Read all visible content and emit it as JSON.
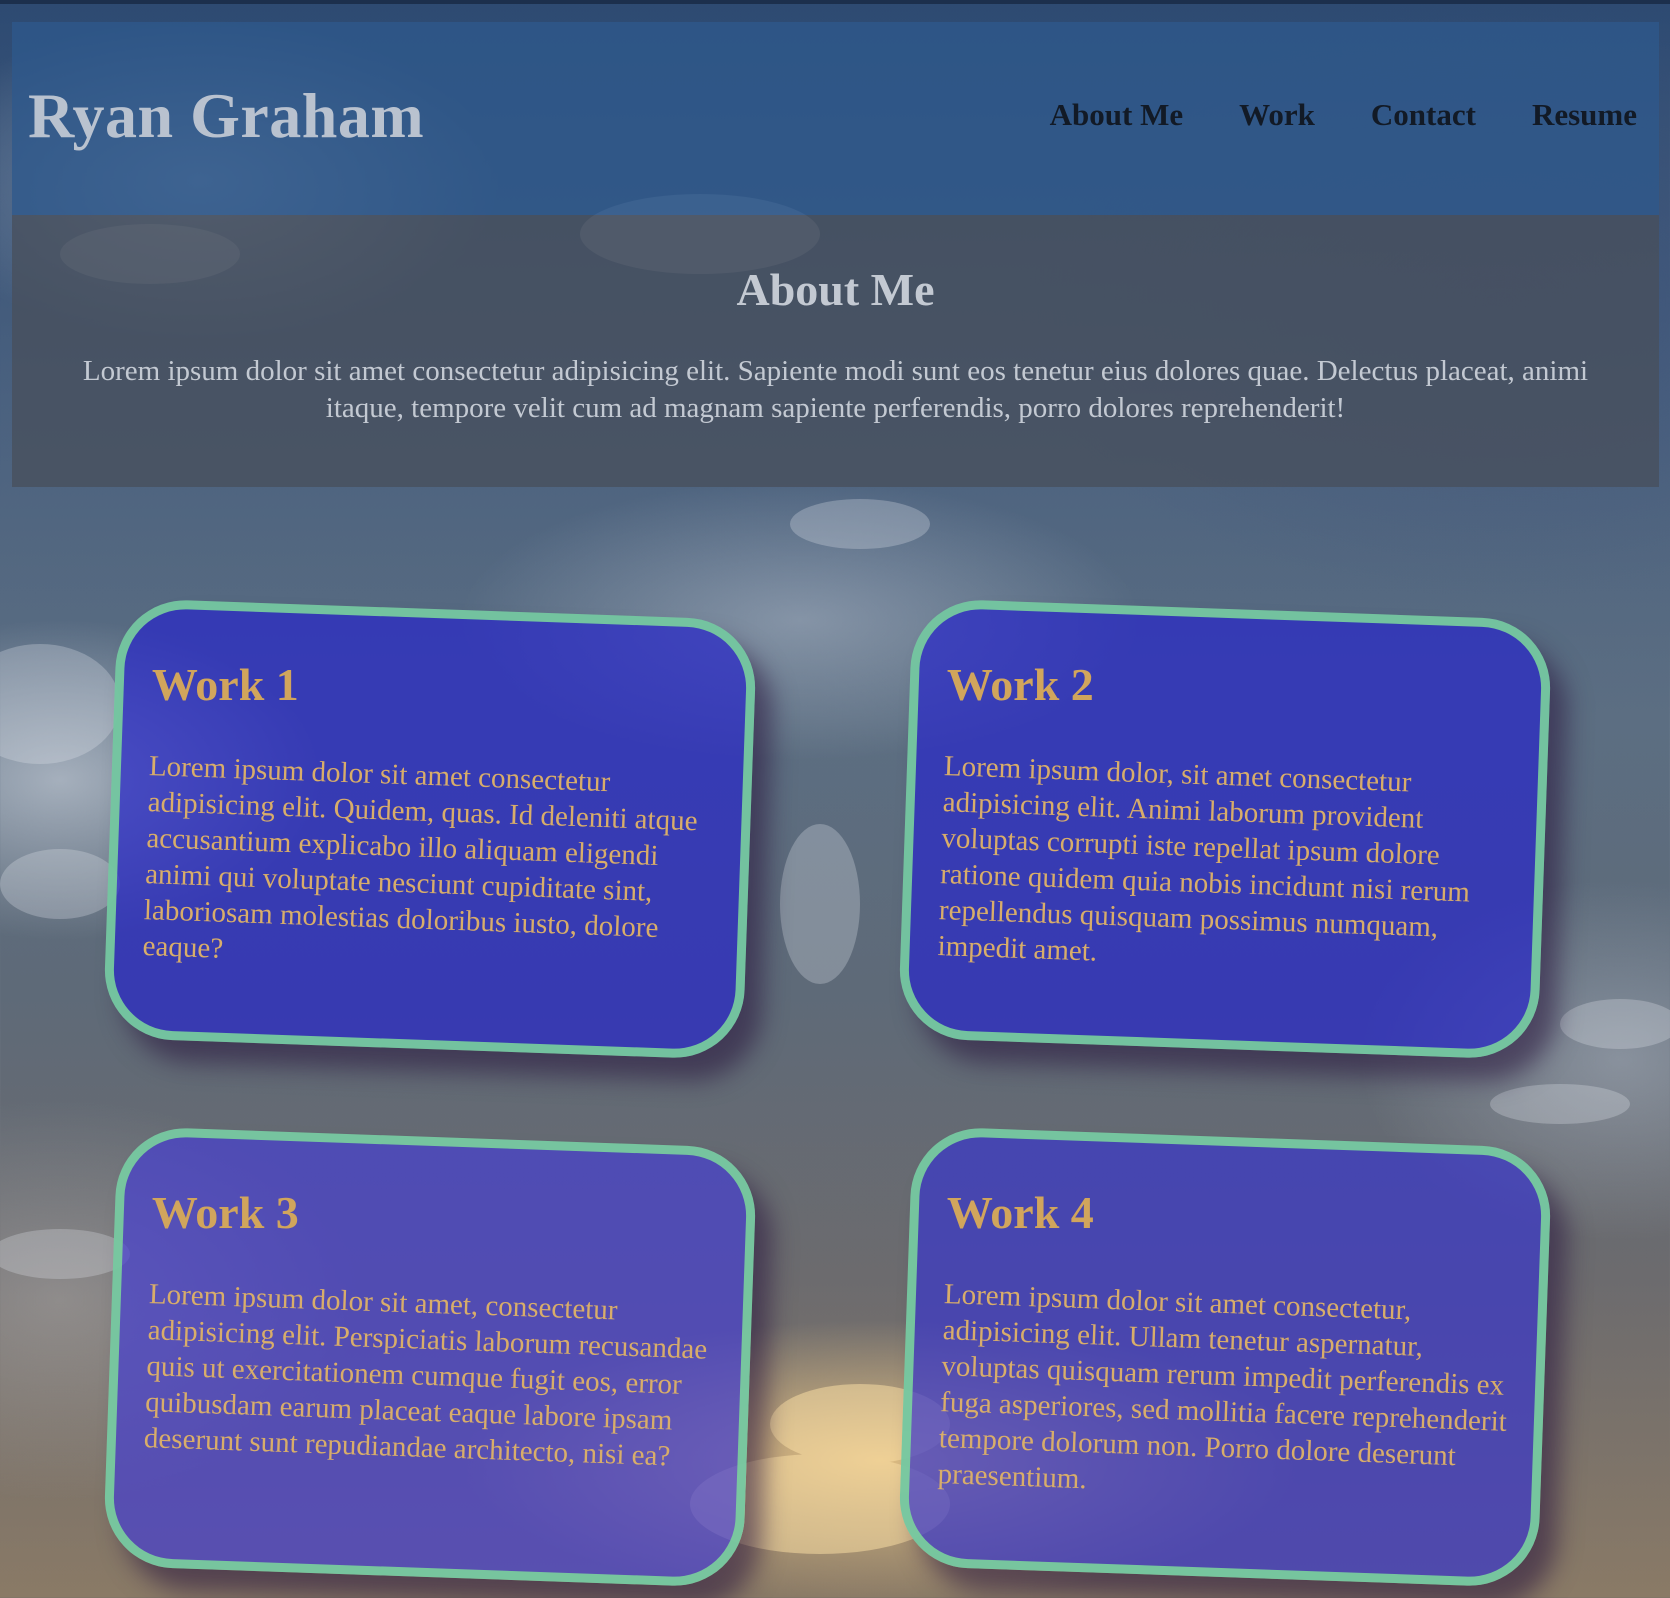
{
  "header": {
    "brand": "Ryan Graham",
    "nav": [
      "About Me",
      "Work",
      "Contact",
      "Resume"
    ]
  },
  "about": {
    "title": "About Me",
    "text": "Lorem ipsum dolor sit amet consectetur adipisicing elit. Sapiente modi sunt eos tenetur eius dolores quae. Delectus placeat, animi itaque, tempore velit cum ad magnam sapiente perferendis, porro dolores reprehenderit!"
  },
  "works": [
    {
      "title": "Work 1",
      "text": "Lorem ipsum dolor sit amet consectetur adipisicing elit. Quidem, quas. Id deleniti atque accusantium explicabo illo aliquam eligendi animi qui voluptate nesciunt cupiditate sint, laboriosam molestias doloribus iusto, dolore eaque?"
    },
    {
      "title": "Work 2",
      "text": "Lorem ipsum dolor, sit amet consectetur adipisicing elit. Animi laborum provident voluptas corrupti iste repellat ipsum dolore ratione quidem quia nobis incidunt nisi rerum repellendus quisquam possimus numquam, impedit amet."
    },
    {
      "title": "Work 3",
      "text": "Lorem ipsum dolor sit amet, consectetur adipisicing elit. Perspiciatis laborum recusandae quis ut exercitationem cumque fugit eos, error quibusdam earum placeat eaque labore ipsam deserunt sunt repudiandae architecto, nisi ea?"
    },
    {
      "title": "Work 4",
      "text": "Lorem ipsum dolor sit amet consectetur, adipisicing elit. Ullam tenetur aspernatur, voluptas quisquam rerum impedit perferendis ex fuga asperiores, sed mollitia facere reprehenderit tempore dolorum non. Porro dolore deserunt praesentium."
    }
  ],
  "colors": {
    "header_bg": "#2e588c",
    "about_bg": "#48505c",
    "card_bg": "#2828c8",
    "card_border": "#7cd69c",
    "card_text": "#d2a860",
    "nav_text": "#121a26",
    "brand_text": "#b9c2cf"
  }
}
